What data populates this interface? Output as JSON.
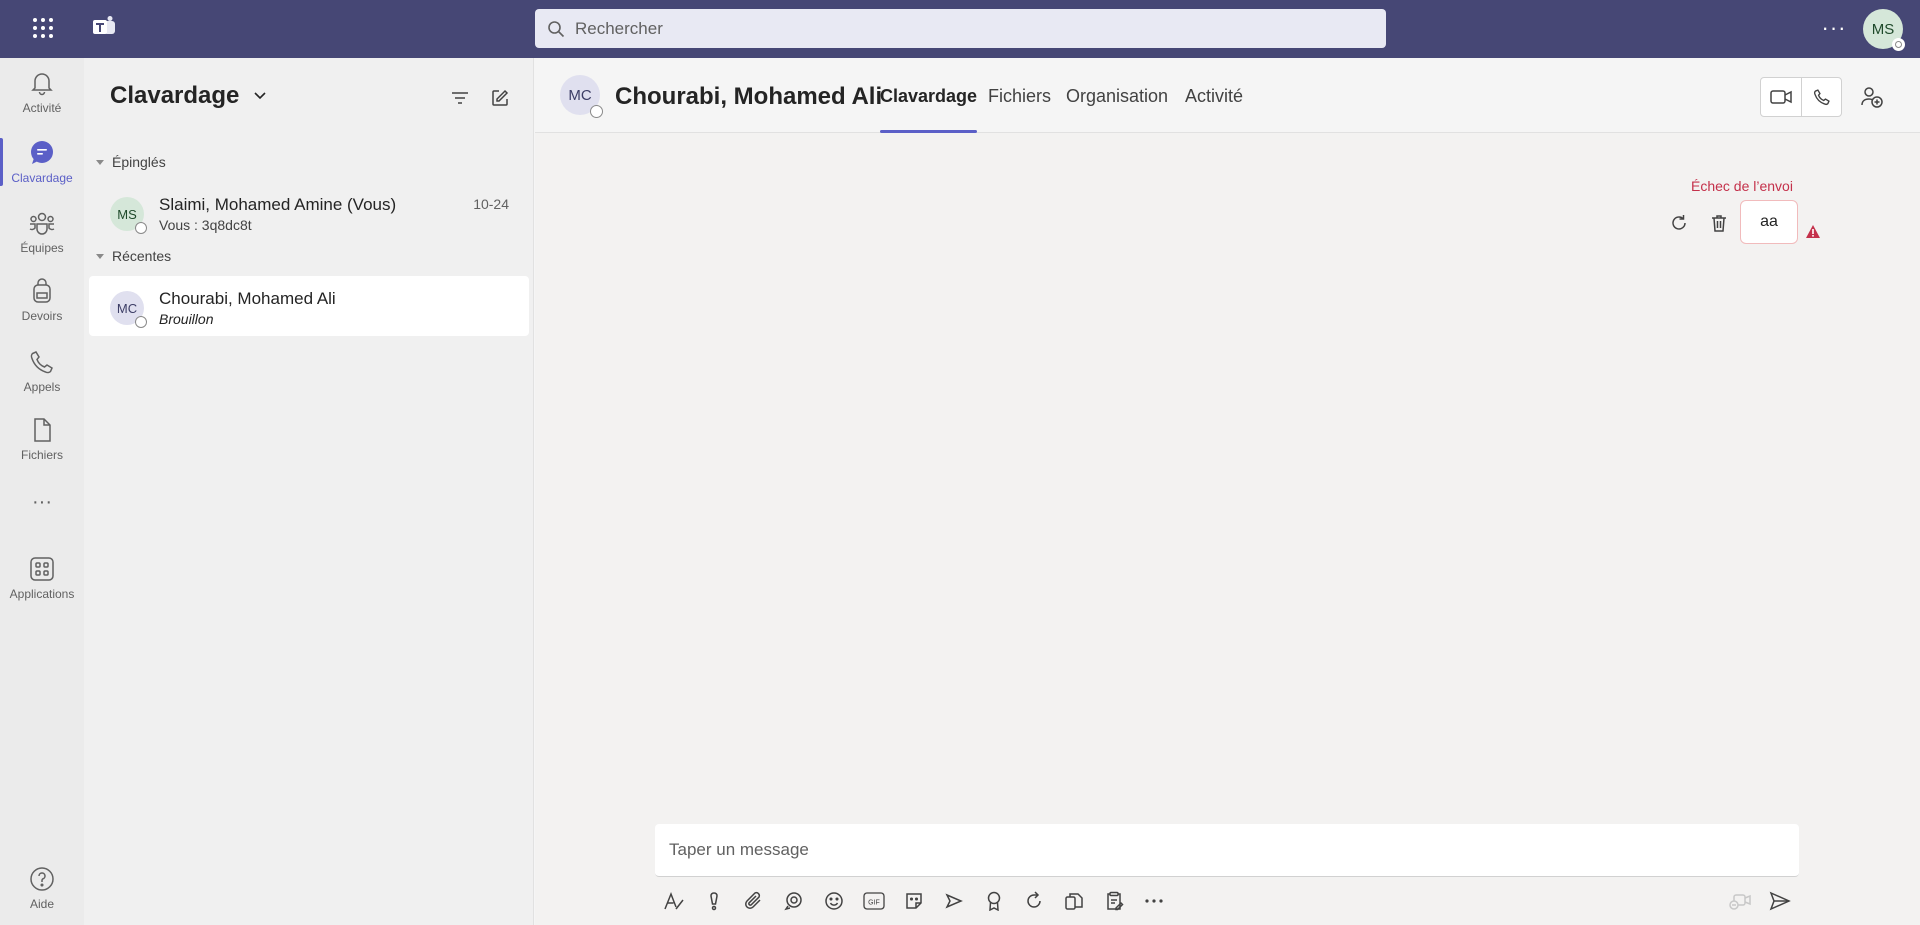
{
  "topbar": {
    "search_placeholder": "Rechercher",
    "more_label": "···",
    "user_initials": "MS",
    "brand_color": "#464775"
  },
  "rail": {
    "items": [
      {
        "label": "Activité",
        "icon": "bell-icon"
      },
      {
        "label": "Clavardage",
        "icon": "chat-icon",
        "active": true
      },
      {
        "label": "Équipes",
        "icon": "teams-icon"
      },
      {
        "label": "Devoirs",
        "icon": "backpack-icon"
      },
      {
        "label": "Appels",
        "icon": "phone-icon"
      },
      {
        "label": "Fichiers",
        "icon": "file-icon"
      },
      {
        "label": "···",
        "icon": "more-icon"
      },
      {
        "label": "Applications",
        "icon": "apps-icon"
      },
      {
        "label": "Aide",
        "icon": "help-icon"
      }
    ]
  },
  "panel": {
    "title": "Clavardage",
    "pinned_header": "Épinglés",
    "recent_header": "Récentes",
    "pinned": [
      {
        "initials": "MS",
        "name": "Slaimi, Mohamed Amine (Vous)",
        "sub": "Vous : 3q8dc8t",
        "time": "10-24"
      }
    ],
    "recent": [
      {
        "initials": "MC",
        "name": "Chourabi, Mohamed Ali",
        "sub": "Brouillon"
      }
    ]
  },
  "conversation": {
    "initials": "MC",
    "name": "Chourabi, Mohamed Ali",
    "tabs": [
      "Clavardage",
      "Fichiers",
      "Organisation",
      "Activité"
    ],
    "active_tab": "Clavardage",
    "message": {
      "status": "Échec de l’envoi",
      "text": "aa",
      "status_color": "#c4314b"
    },
    "compose_placeholder": "Taper un message"
  }
}
